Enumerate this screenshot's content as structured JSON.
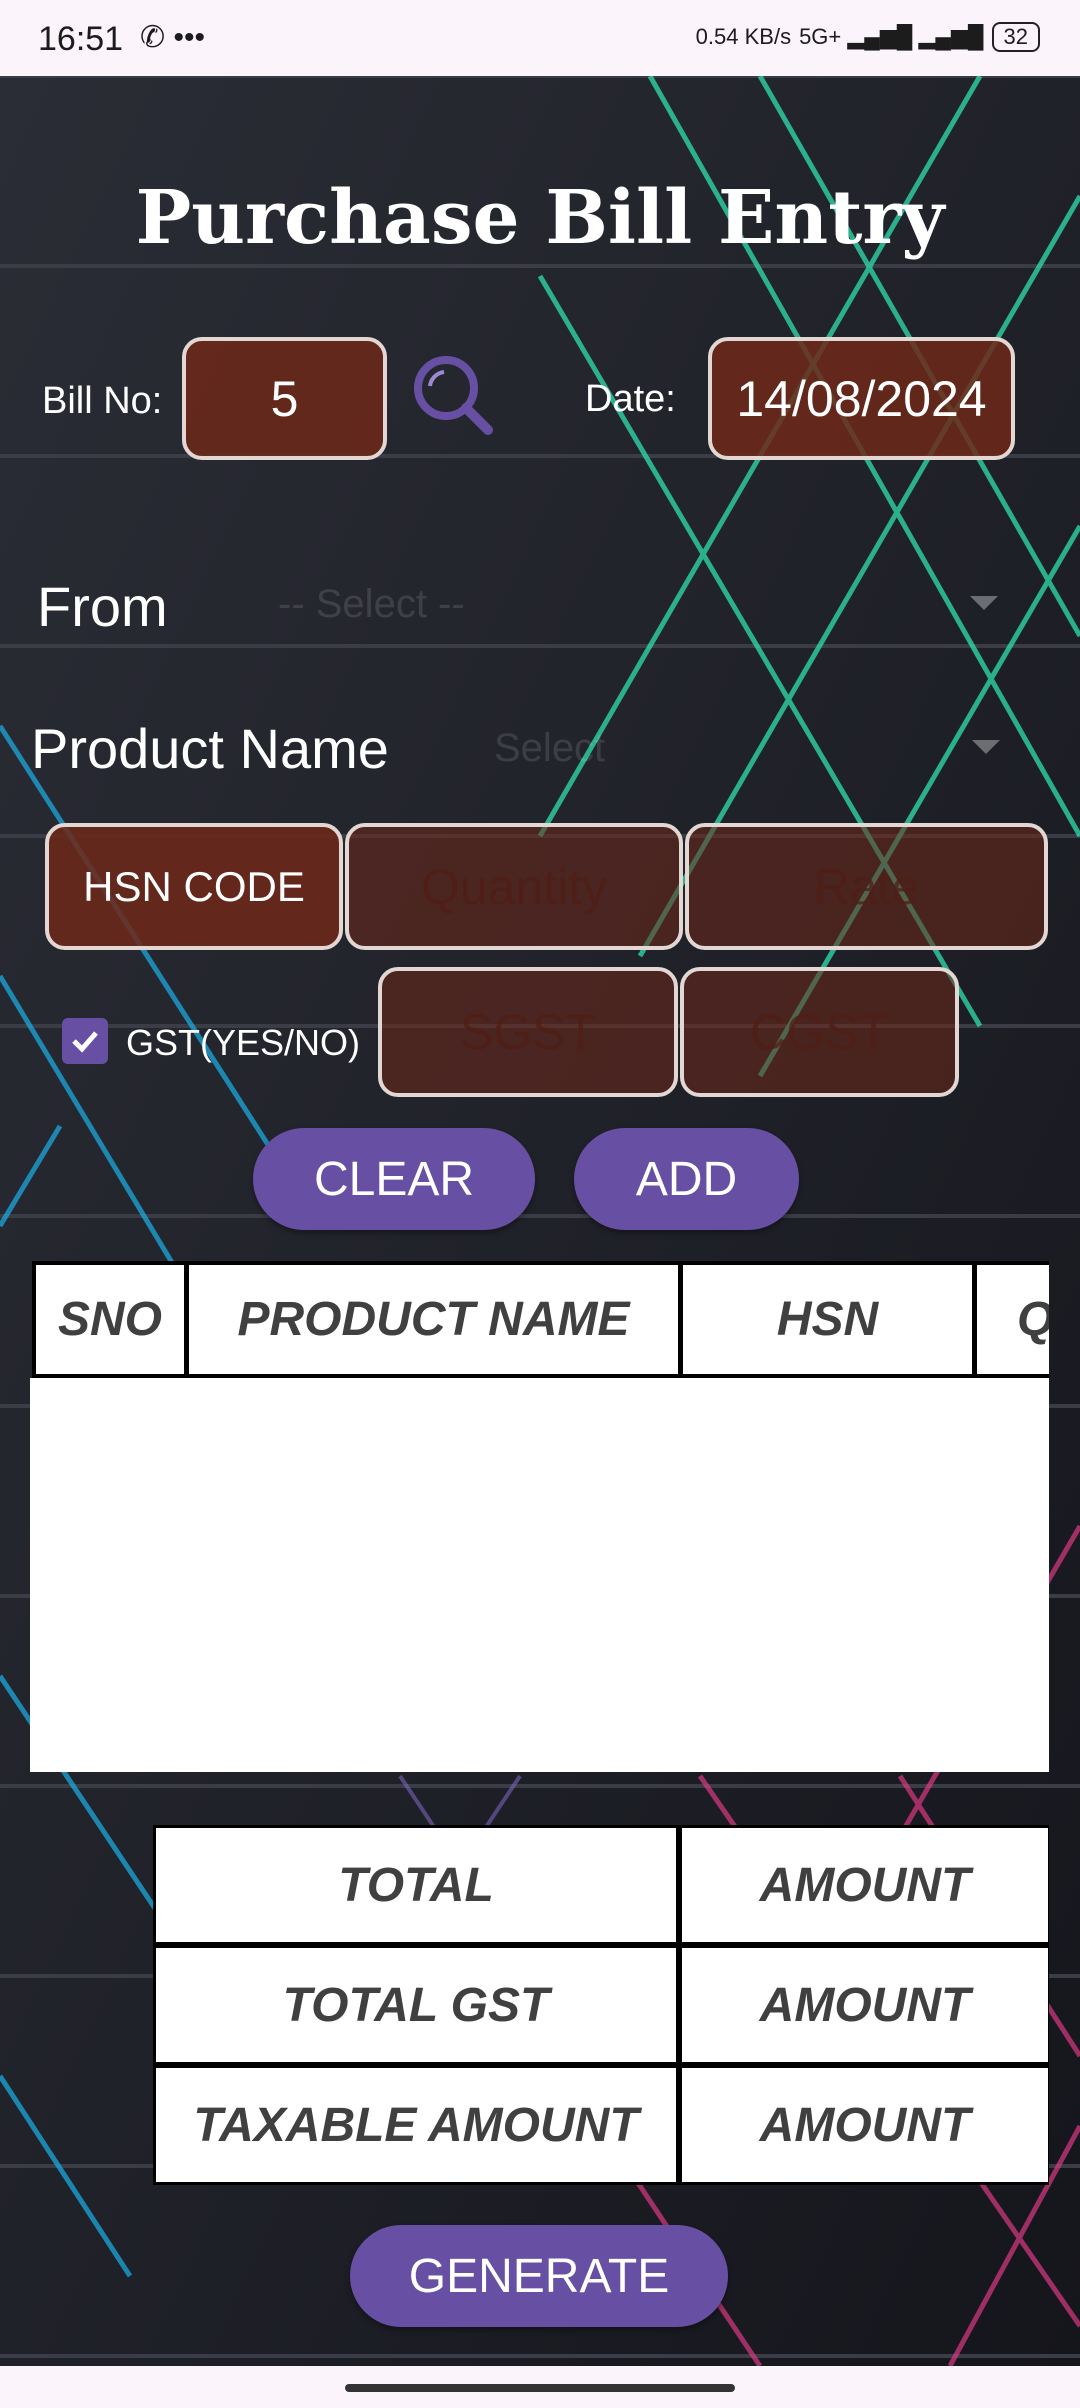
{
  "status_bar": {
    "time": "16:51",
    "icons_left": "✆ •••",
    "net_speed": "0.54 KB/s",
    "signal_info": "5G+ ▂▄▆█  ▂▄▆█",
    "battery": "32"
  },
  "page": {
    "title": "Purchase Bill Entry"
  },
  "bill": {
    "label": "Bill No:",
    "value": "5"
  },
  "date": {
    "label": "Date:",
    "value": "14/08/2024"
  },
  "from": {
    "label": "From",
    "placeholder": "-- Select --"
  },
  "product": {
    "label": "Product Name",
    "placeholder": "Select"
  },
  "fields": {
    "hsn": "HSN CODE",
    "quantity_placeholder": "Quantity",
    "rate_placeholder": "Rate",
    "sgst_placeholder": "SGST",
    "cgst_placeholder": "CGST"
  },
  "gst": {
    "label": "GST(YES/NO)",
    "checked": true
  },
  "buttons": {
    "clear": "CLEAR",
    "add": "ADD",
    "generate": "GENERATE"
  },
  "table": {
    "headers": [
      "SNO",
      "PRODUCT NAME",
      "HSN",
      "Q"
    ]
  },
  "summary": {
    "total_label": "TOTAL",
    "total_value": "AMOUNT",
    "gst_label": "TOTAL GST",
    "gst_value": "AMOUNT",
    "taxable_label": "TAXABLE AMOUNT",
    "taxable_value": "AMOUNT"
  },
  "colors": {
    "accent": "#6750a4",
    "field_bg": "#6e2819",
    "bg": "#1a1b22"
  }
}
